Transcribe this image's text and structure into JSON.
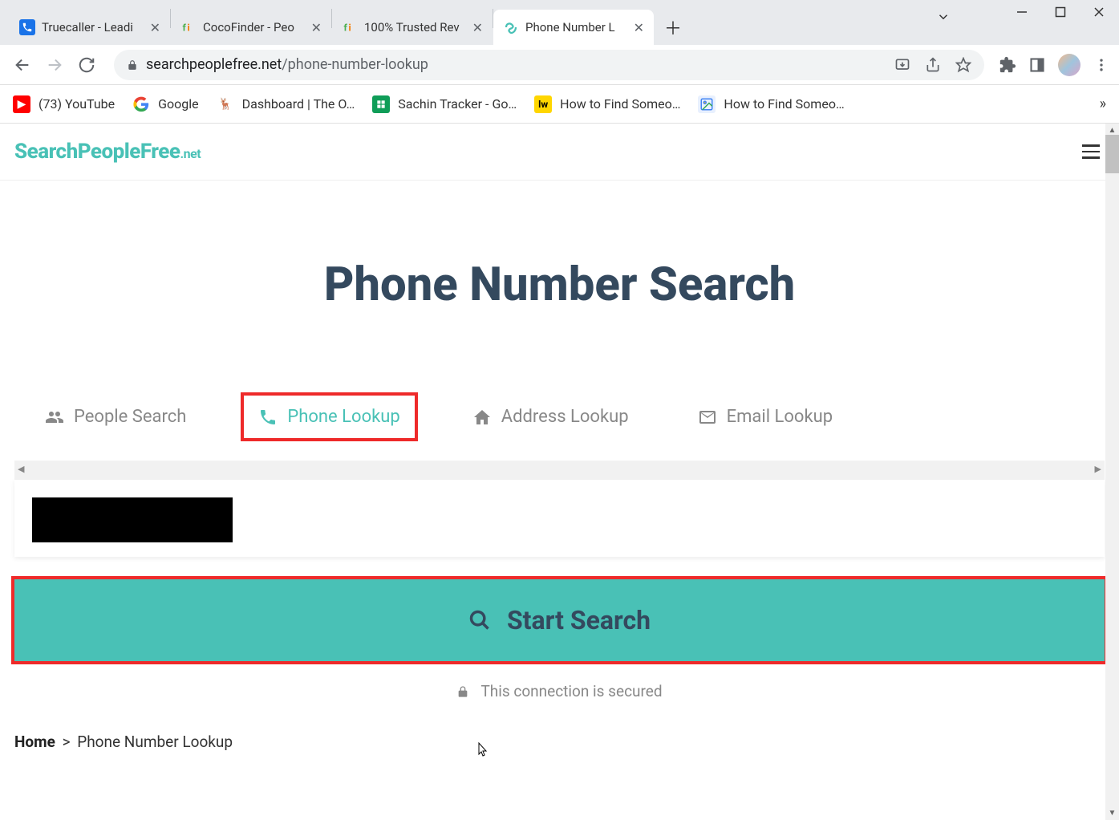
{
  "browser": {
    "tabs": [
      {
        "title": "Truecaller - Leadi",
        "active": false
      },
      {
        "title": "CocoFinder - Peo",
        "active": false
      },
      {
        "title": "100% Trusted Rev",
        "active": false
      },
      {
        "title": "Phone Number L",
        "active": true
      }
    ],
    "url_host": "searchpeoplefree.net",
    "url_path": "/phone-number-lookup"
  },
  "bookmarks": [
    {
      "label": "(73) YouTube",
      "icon": "youtube"
    },
    {
      "label": "Google",
      "icon": "google"
    },
    {
      "label": "Dashboard | The O…",
      "icon": "deer"
    },
    {
      "label": "Sachin Tracker - Go…",
      "icon": "sheets"
    },
    {
      "label": "How to Find Someo…",
      "icon": "lw"
    },
    {
      "label": "How to Find Someo…",
      "icon": "img"
    }
  ],
  "site": {
    "logo_main": "SearchPeopleFree",
    "logo_suffix": ".net"
  },
  "hero": {
    "title": "Phone Number Search"
  },
  "search_tabs": [
    {
      "label": "People Search",
      "icon": "people"
    },
    {
      "label": "Phone Lookup",
      "icon": "phone",
      "active": true
    },
    {
      "label": "Address Lookup",
      "icon": "home"
    },
    {
      "label": "Email Lookup",
      "icon": "mail"
    }
  ],
  "search": {
    "button_label": "Start Search",
    "secured_text": "This connection is secured"
  },
  "breadcrumb": {
    "home": "Home",
    "sep": ">",
    "current": "Phone Number Lookup"
  }
}
